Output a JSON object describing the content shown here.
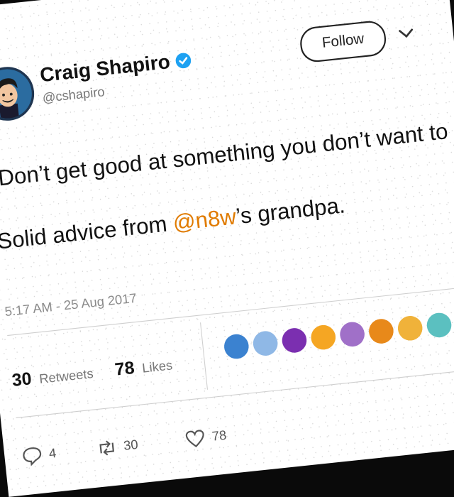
{
  "tweet": {
    "name": "Craig Shapiro",
    "handle": "@cshapiro",
    "follow_label": "Follow",
    "text_line1": "“Don’t get good at something you don’t want to do.”",
    "text_line2_pre": "Solid advice from ",
    "mention": "@n8w",
    "text_line2_post": "’s grandpa.",
    "timestamp": "5:17 AM - 25 Aug 2017"
  },
  "stats": {
    "retweets_count": "30",
    "retweets_label": "Retweets",
    "likes_count": "78",
    "likes_label": "Likes"
  },
  "likers": [
    "#3b82d0",
    "#8fb8e6",
    "#7b2fb0",
    "#f5a623",
    "#a070c8",
    "#e8891a",
    "#f0b23a",
    "#5bc0c0",
    "#0e1e5a"
  ],
  "actions": {
    "reply_count": "4",
    "retweet_count": "30",
    "like_count": "78"
  },
  "colors": {
    "mention": "#e07b00",
    "verified": "#1da1f2"
  },
  "icons": [
    "verified-icon",
    "chevron-down-icon",
    "reply-icon",
    "retweet-icon",
    "heart-icon"
  ]
}
